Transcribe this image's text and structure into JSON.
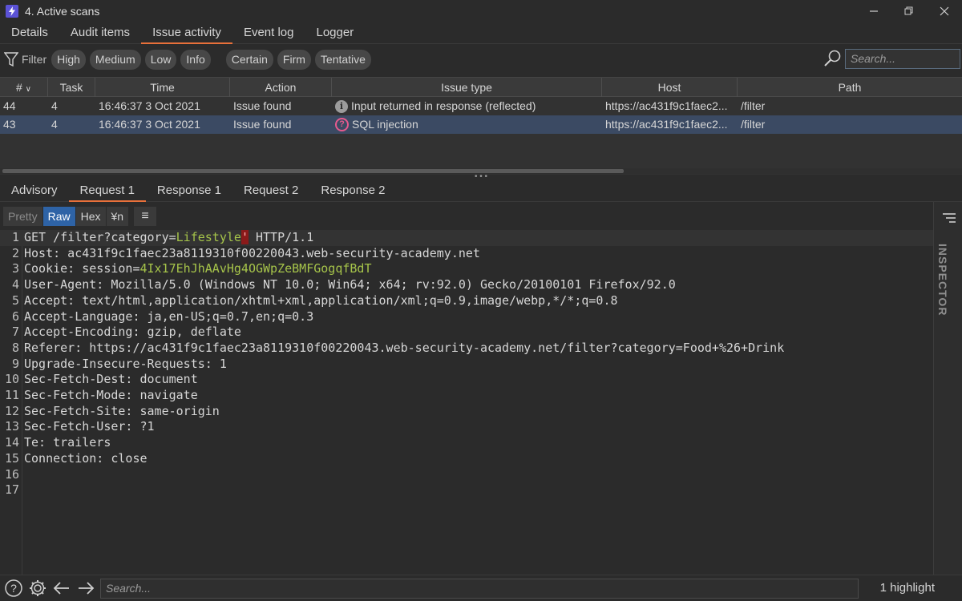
{
  "window": {
    "title": "4. Active scans",
    "app_icon": "lightning-icon",
    "controls": [
      "minimize-icon",
      "restore-icon",
      "close-icon"
    ]
  },
  "top_tabs": [
    {
      "label": "Details",
      "active": false
    },
    {
      "label": "Audit items",
      "active": false
    },
    {
      "label": "Issue activity",
      "active": true
    },
    {
      "label": "Event log",
      "active": false
    },
    {
      "label": "Logger",
      "active": false
    }
  ],
  "filter": {
    "label": "Filter",
    "severity": [
      "High",
      "Medium",
      "Low",
      "Info"
    ],
    "confidence": [
      "Certain",
      "Firm",
      "Tentative"
    ],
    "search_placeholder": "Search..."
  },
  "table": {
    "columns": [
      "#",
      "Task",
      "Time",
      "Action",
      "Issue type",
      "Host",
      "Path"
    ],
    "rows": [
      {
        "num": "44",
        "task": "4",
        "time": "16:46:37 3 Oct 2021",
        "action": "Issue found",
        "icon": "info-icon",
        "issue": "Input returned in response (reflected)",
        "host": "https://ac431f9c1faec2...",
        "path": "/filter",
        "selected": false
      },
      {
        "num": "43",
        "task": "4",
        "time": "16:46:37 3 Oct 2021",
        "action": "Issue found",
        "icon": "question-icon",
        "issue": "SQL injection",
        "host": "https://ac431f9c1faec2...",
        "path": "/filter",
        "selected": true
      }
    ]
  },
  "bottom_tabs": [
    {
      "label": "Advisory",
      "active": false
    },
    {
      "label": "Request 1",
      "active": true
    },
    {
      "label": "Response 1",
      "active": false
    },
    {
      "label": "Request 2",
      "active": false
    },
    {
      "label": "Response 2",
      "active": false
    }
  ],
  "editor_toolbar": {
    "pretty": "Pretty",
    "raw": "Raw",
    "hex": "Hex",
    "newline": "¥n"
  },
  "request": {
    "line1": {
      "pre": "GET /filter?category=",
      "value": "Lifestyle",
      "mark": "'",
      "post": " HTTP/1.1"
    },
    "line3": {
      "pre": "Cookie: session=",
      "value": "4Ix17EhJhAAvHg4OGWpZeBMFGogqfBdT"
    },
    "lines": [
      "Host: ac431f9c1faec23a8119310f00220043.web-security-academy.net",
      "User-Agent: Mozilla/5.0 (Windows NT 10.0; Win64; x64; rv:92.0) Gecko/20100101 Firefox/92.0",
      "Accept: text/html,application/xhtml+xml,application/xml;q=0.9,image/webp,*/*;q=0.8",
      "Accept-Language: ja,en-US;q=0.7,en;q=0.3",
      "Accept-Encoding: gzip, deflate",
      "Referer: https://ac431f9c1faec23a8119310f00220043.web-security-academy.net/filter?category=Food+%26+Drink",
      "Upgrade-Insecure-Requests: 1",
      "Sec-Fetch-Dest: document",
      "Sec-Fetch-Mode: navigate",
      "Sec-Fetch-Site: same-origin",
      "Sec-Fetch-User: ?1",
      "Te: trailers",
      "Connection: close",
      "",
      ""
    ],
    "line_numbers": [
      "1",
      "2",
      "3",
      "4",
      "5",
      "6",
      "7",
      "8",
      "9",
      "10",
      "11",
      "12",
      "13",
      "14",
      "15",
      "16",
      "17"
    ]
  },
  "inspector": {
    "label": "INSPECTOR"
  },
  "statusbar": {
    "search_placeholder": "Search...",
    "highlight_count": "1 highlight"
  },
  "colors": {
    "accent": "#e8703a",
    "selected_row": "#3b4a63",
    "raw_active": "#2e63a6",
    "param_value": "#a6c44a",
    "marker": "#8b1a1a"
  }
}
